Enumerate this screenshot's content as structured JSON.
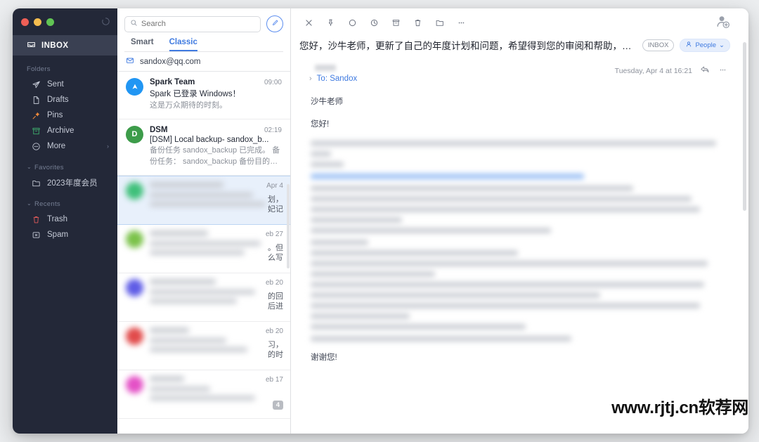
{
  "window": {
    "traffic_lights": [
      "close",
      "minimize",
      "zoom"
    ],
    "refresh_icon": "refresh-icon"
  },
  "sidebar": {
    "inbox": {
      "label": "INBOX",
      "icon": "inbox-icon"
    },
    "sections": [
      {
        "title": "Folders",
        "collapsible": false,
        "items": [
          {
            "label": "Sent",
            "icon": "paper-plane-icon"
          },
          {
            "label": "Drafts",
            "icon": "document-icon"
          },
          {
            "label": "Pins",
            "icon": "pin-icon"
          },
          {
            "label": "Archive",
            "icon": "archive-icon"
          },
          {
            "label": "More",
            "icon": "ellipsis-circle-icon",
            "chevron": "›"
          }
        ]
      },
      {
        "title": "Favorites",
        "collapsible": true,
        "items": [
          {
            "label": "2023年度会员",
            "icon": "folder-icon"
          }
        ]
      },
      {
        "title": "Recents",
        "collapsible": true,
        "items": [
          {
            "label": "Trash",
            "icon": "trash-icon"
          },
          {
            "label": "Spam",
            "icon": "spam-icon"
          }
        ]
      }
    ]
  },
  "list": {
    "search": {
      "placeholder": "Search",
      "value": "",
      "icon": "search-icon"
    },
    "compose_icon": "compose-pencil-icon",
    "tabs": [
      {
        "label": "Smart",
        "active": false
      },
      {
        "label": "Classic",
        "active": true
      }
    ],
    "account": {
      "label": "sandox@qq.com",
      "icon": "envelope-icon"
    },
    "items": [
      {
        "avatar_letter": "",
        "avatar_color": "#2196f3",
        "from": "Spark Team",
        "subject": "Spark 已登录 Windows！",
        "preview": "这是万众期待的时刻。",
        "time": "09:00",
        "blurred": false,
        "selected": false,
        "badge": ""
      },
      {
        "avatar_letter": "D",
        "avatar_color": "#3d9c4a",
        "from": "DSM",
        "subject": "[DSM] Local backup- sandox_b...",
        "preview": "备份任务 sandox_backup 已完成。 备份任务： sandox_backup 备份目的地： backup /",
        "time": "02:19",
        "blurred": false,
        "selected": false,
        "badge": ""
      },
      {
        "avatar_letter": "",
        "avatar_color": "#3fc07a",
        "from": "",
        "subject": "",
        "preview": "",
        "time": "Apr 4",
        "blurred": true,
        "selected": true,
        "badge": "",
        "tail_lines": [
          "划，",
          "妃记"
        ]
      },
      {
        "avatar_letter": "",
        "avatar_color": "#7bc24a",
        "from": "",
        "subject": "",
        "preview": "",
        "time": "eb 27",
        "blurred": true,
        "selected": false,
        "badge": "",
        "tail_lines": [
          "。但",
          "么写"
        ]
      },
      {
        "avatar_letter": "",
        "avatar_color": "#5e5ce6",
        "from": "",
        "subject": "",
        "preview": "",
        "time": "eb 20",
        "blurred": true,
        "selected": false,
        "badge": "",
        "tail_lines": [
          "的回",
          "后进"
        ]
      },
      {
        "avatar_letter": "",
        "avatar_color": "#e14b4b",
        "from": "",
        "subject": "",
        "preview": "",
        "time": "eb 20",
        "blurred": true,
        "selected": false,
        "badge": "",
        "tail_lines": [
          "习，",
          "的时"
        ]
      },
      {
        "avatar_letter": "",
        "avatar_color": "#e451c6",
        "from": "",
        "subject": "",
        "preview": "",
        "time": "eb 17",
        "blurred": true,
        "selected": false,
        "badge": "4",
        "tail_lines": []
      }
    ]
  },
  "reader": {
    "toolbar": [
      {
        "name": "close-icon",
        "label": "Close"
      },
      {
        "name": "pin-icon",
        "label": "Pin"
      },
      {
        "name": "unread-circle-icon",
        "label": "Mark unread"
      },
      {
        "name": "clock-icon",
        "label": "Snooze"
      },
      {
        "name": "archive-icon",
        "label": "Archive"
      },
      {
        "name": "trash-icon",
        "label": "Delete"
      },
      {
        "name": "folder-icon",
        "label": "Move to folder"
      },
      {
        "name": "more-icon",
        "label": "More"
      }
    ],
    "add_person_icon": "add-person-icon",
    "subject": "您好，沙牛老师，更新了自己的年度计划和问题，希望得到您的审阅和帮助，谢谢。",
    "badges": [
      {
        "label": "INBOX",
        "style": "outline"
      },
      {
        "label": "People",
        "style": "blue",
        "icon": "person-icon",
        "chevron": "⌄"
      }
    ],
    "message": {
      "sender_blurred": true,
      "to_label": "To: Sandox",
      "expand_chevron": "›",
      "date": "Tuesday, Apr 4 at 16:21",
      "reply_icon": "reply-icon",
      "more_icon": "more-icon",
      "greeting_name": "沙牛老师",
      "greeting": "您好!",
      "closing": "谢谢您!"
    },
    "watermark": "www.rjtj.cn软荐网"
  },
  "colors": {
    "sidebar_bg": "#232838",
    "accent_blue": "#3f7ae0",
    "selected_row": "#e8f0fb"
  }
}
